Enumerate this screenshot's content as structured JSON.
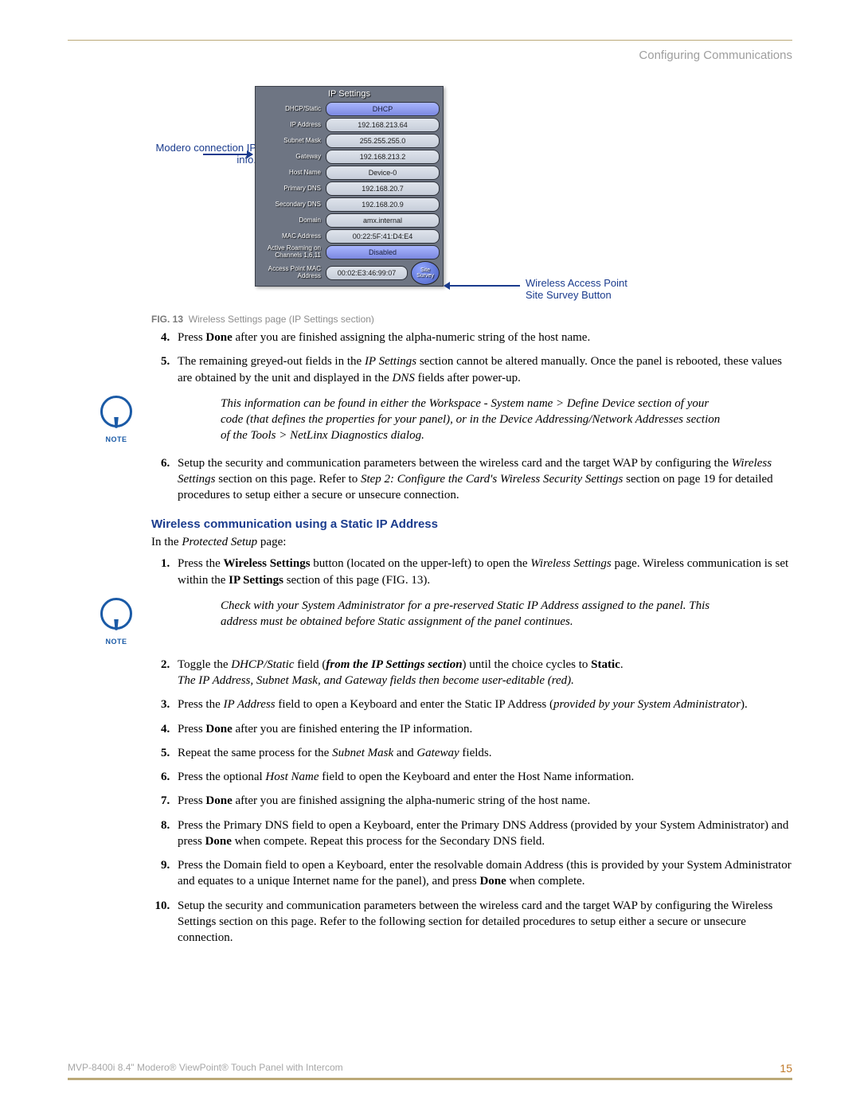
{
  "header": "Configuring Communications",
  "figure": {
    "title": "IP Settings",
    "left_annot": "Modero connection IP info.",
    "right_annot1": "Wireless Access Point",
    "right_annot2": "Site Survey Button",
    "caption_label": "FIG. 13",
    "caption_text": "Wireless Settings page (IP Settings section)",
    "rows": [
      {
        "label": "DHCP/Static",
        "value": "DHCP",
        "blue": true
      },
      {
        "label": "IP Address",
        "value": "192.168.213.64"
      },
      {
        "label": "Subnet Mask",
        "value": "255.255.255.0"
      },
      {
        "label": "Gateway",
        "value": "192.168.213.2"
      },
      {
        "label": "Host Name",
        "value": "Device-0"
      },
      {
        "label": "Primary DNS",
        "value": "192.168.20.7"
      },
      {
        "label": "Secondary DNS",
        "value": "192.168.20.9"
      },
      {
        "label": "Domain",
        "value": "amx.internal"
      },
      {
        "label": "MAC Address",
        "value": "00:22:5F:41:D4:E4"
      },
      {
        "label": "Active Roaming on Channels 1,6,11",
        "value": "Disabled",
        "blue": true
      }
    ],
    "ap_label": "Access Point MAC Address",
    "ap_value": "00:02:E3:46:99:07",
    "survey": "Site Survey"
  },
  "list1": {
    "4": "Press <b>Done</b> after you are finished assigning the alpha-numeric string of the host name.",
    "5": "The remaining greyed-out fields in the <i>IP Settings</i> section cannot be altered manually. Once the panel is rebooted, these values are obtained by the unit and displayed in the <i>DNS</i> fields after power-up."
  },
  "note1": "This information can be found in either the Workspace - System name > Define Device section of your code (that defines the properties for your panel), or in the Device Addressing/Network Addresses section of the Tools > NetLinx Diagnostics dialog.",
  "list1b": {
    "6": "Setup the security and communication parameters between the wireless card and the target WAP by configuring the <i>Wireless Settings</i> section on this page. Refer to <i>Step 2: Configure the Card's Wireless Security Settings</i> section on page 19 for detailed procedures to setup either a secure or unsecure connection."
  },
  "section2": "Wireless communication using a Static IP Address",
  "para2": "In the <i>Protected Setup</i> page:",
  "list2a": {
    "1": "Press the <b>Wireless Settings</b> button (located on the upper-left) to open the <i>Wireless Settings</i> page. Wireless communication is set within the <b>IP Settings</b> section of this page (FIG. 13)."
  },
  "note2": "Check with your System Administrator for a pre-reserved Static IP Address assigned to the panel. This address must be obtained before Static assignment of the panel continues.",
  "list2b": {
    "2": "Toggle the <i>DHCP/Static</i> field (<i><b>from the IP Settings section</b></i>) until the choice cycles to <b>Static</b>.<br><i>The IP Address, Subnet Mask, and Gateway fields then become user-editable (red).</i>",
    "3": "Press the <i>IP Address</i> field to open a Keyboard and enter the Static IP Address (<i>provided by your System Administrator</i>).",
    "4": "Press <b>Done</b> after you are finished entering the IP information.",
    "5": "Repeat the same process for the <i>Subnet Mask</i> and <i>Gateway</i> fields.",
    "6": "Press the optional <i>Host Name</i> field to open the Keyboard and enter the Host Name information.",
    "7": "Press <b>Done</b> after you are finished assigning the alpha-numeric string of the host name.",
    "8": "Press the Primary DNS field to open a Keyboard, enter the Primary DNS Address (provided by your System Administrator) and press <b>Done</b> when compete. Repeat this process for the Secondary DNS field.",
    "9": "Press the Domain field to open a Keyboard, enter the resolvable domain Address (this is provided by your System Administrator and equates to a unique Internet name for the panel), and press <b>Done</b> when complete.",
    "10": "Setup the security and communication parameters between the wireless card and the target WAP by configuring the Wireless Settings section on this page. Refer to the following section for detailed procedures to setup either a secure or unsecure connection."
  },
  "footer": {
    "product": "MVP-8400i 8.4\" Modero® ViewPoint® Touch Panel with Intercom",
    "page": "15"
  },
  "note_label": "NOTE"
}
